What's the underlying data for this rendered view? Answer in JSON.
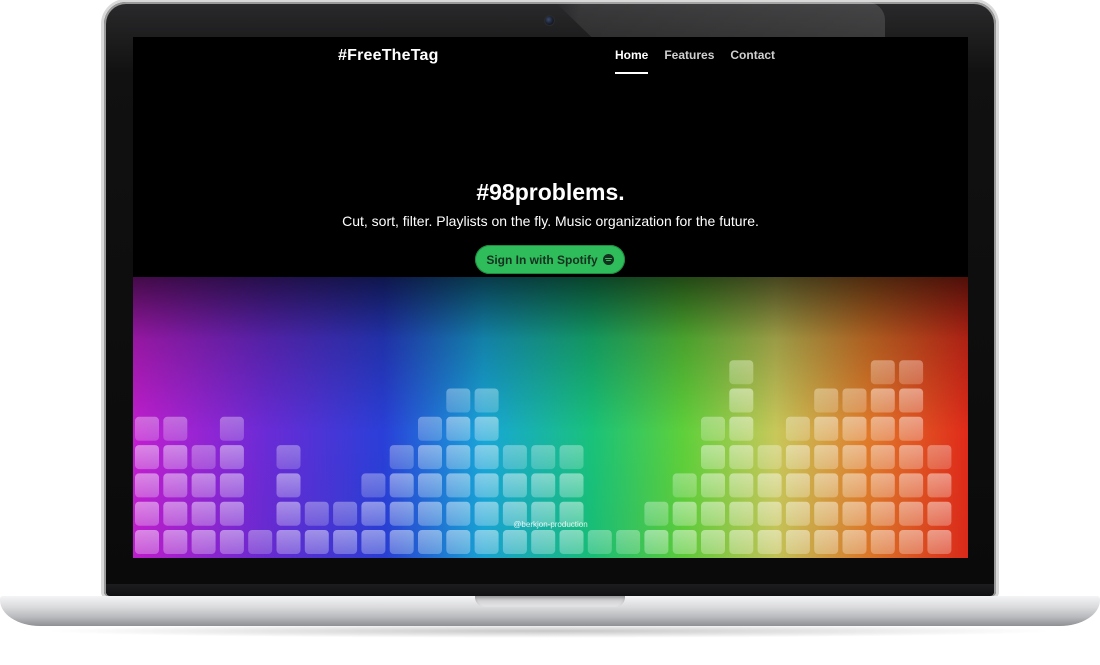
{
  "site": {
    "brand": "#FreeTheTag",
    "nav": [
      {
        "label": "Home",
        "active": true
      },
      {
        "label": "Features",
        "active": false
      },
      {
        "label": "Contact",
        "active": false
      }
    ]
  },
  "hero": {
    "title": "#98problems.",
    "subtitle": "Cut, sort, filter. Playlists on the fly. Music organization for the future.",
    "cta_label": "Sign In with Spotify",
    "cta_icon": "spotify-icon",
    "cta_color": "#2fbd5b"
  },
  "background": {
    "credit": "@berkjon-production"
  }
}
